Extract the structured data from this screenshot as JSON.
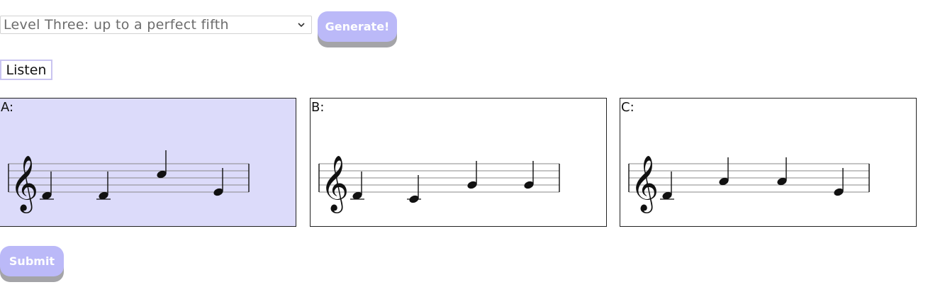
{
  "level_select": {
    "value": "Level Three: up to a perfect fifth"
  },
  "buttons": {
    "generate": "Generate!",
    "listen": "Listen",
    "submit": "Submit"
  },
  "options": [
    {
      "label": "A:",
      "selected": true,
      "notes": [
        "D4",
        "D4",
        "C5",
        "E4"
      ]
    },
    {
      "label": "B:",
      "selected": false,
      "notes": [
        "D4",
        "C4",
        "G4",
        "G4"
      ]
    },
    {
      "label": "C:",
      "selected": false,
      "notes": [
        "D4",
        "A4",
        "A4",
        "E4"
      ]
    }
  ],
  "colors": {
    "accent": "#bbb9f8",
    "selected_bg": "#dcdbfa",
    "button_shadow": "#a4a4a8"
  }
}
